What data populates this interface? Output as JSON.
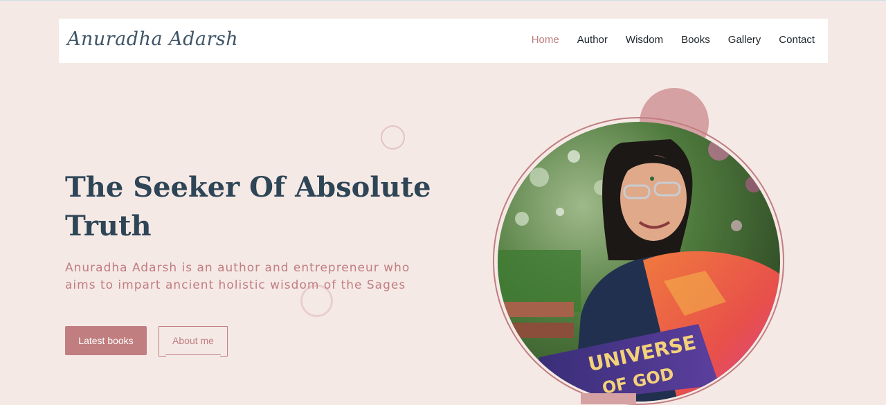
{
  "brand": {
    "logo_text": "Anuradha Adarsh"
  },
  "nav": {
    "items": [
      {
        "label": "Home",
        "active": true
      },
      {
        "label": "Author",
        "active": false
      },
      {
        "label": "Wisdom",
        "active": false
      },
      {
        "label": "Books",
        "active": false
      },
      {
        "label": "Gallery",
        "active": false
      },
      {
        "label": "Contact",
        "active": false
      }
    ]
  },
  "hero": {
    "title": "The Seeker Of Absolute Truth",
    "subtitle": "Anuradha Adarsh is an author and entrepreneur who aims to impart ancient holistic wisdom of the Sages",
    "primary_button": "Latest books",
    "secondary_button": "About me",
    "photo": {
      "alt": "Anuradha Adarsh reading a book",
      "book_title_line1": "UNIVERSE",
      "book_title_line2": "OF GOD"
    }
  },
  "colors": {
    "background": "#f5e9e6",
    "accent": "#c07e80",
    "heading": "#2e4556",
    "nav_text": "#1d2329"
  }
}
